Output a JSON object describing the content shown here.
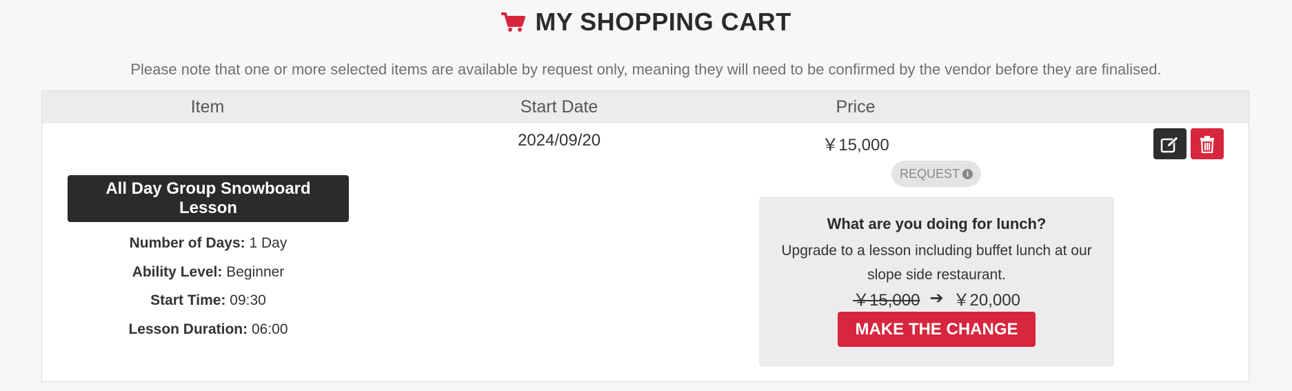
{
  "header": {
    "title": "MY SHOPPING CART",
    "icon": "cart-icon",
    "accent": "#d7263d"
  },
  "notice": "Please note that one or more selected items are available by request only, meaning they will need to be confirmed by the vendor before they are finalised.",
  "table": {
    "columns": {
      "item": "Item",
      "start_date": "Start Date",
      "price": "Price"
    },
    "row": {
      "product_title": "All Day Group Snowboard Lesson",
      "details": [
        {
          "label": "Number of Days:",
          "value": "1 Day"
        },
        {
          "label": "Ability Level:",
          "value": "Beginner"
        },
        {
          "label": "Start Time:",
          "value": "09:30"
        },
        {
          "label": "Lesson Duration:",
          "value": "06:00"
        }
      ],
      "start_date": "2024/09/20",
      "price": "￥15,000",
      "status_badge": "REQUEST",
      "actions": {
        "edit_icon": "edit-icon",
        "delete_icon": "trash-icon"
      }
    }
  },
  "upsell": {
    "title": "What are you doing for lunch?",
    "text": "Upgrade to a lesson including buffet lunch at our slope side restaurant.",
    "old_price": "￥15,000",
    "new_price": "￥20,000",
    "button_label": "MAKE THE CHANGE"
  }
}
